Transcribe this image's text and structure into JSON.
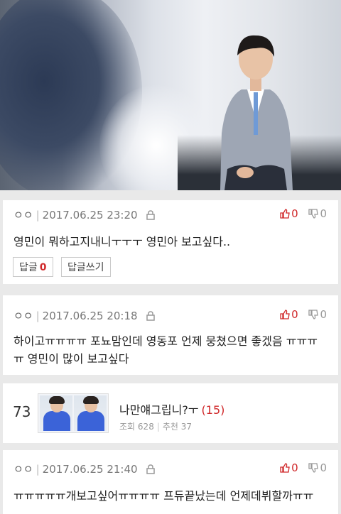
{
  "hero": {
    "alt": ""
  },
  "comments": [
    {
      "author": "ㅇㅇ",
      "date": "2017.06.25 23:20",
      "up": "0",
      "down": "0",
      "text": "영민이 뭐하고지내니ㅜㅜㅜ 영민아 보고싶다..",
      "reply_label": "답글",
      "reply_count": "0",
      "write_reply_label": "답글쓰기"
    },
    {
      "author": "ㅇㅇ",
      "date": "2017.06.25 20:18",
      "up": "0",
      "down": "0",
      "text": "하이고ㅠㅠㅠㅠ 포뇨맘인데 영동포 언제 뭉쳤으면 좋겠음 ㅠㅠㅠㅠ 영민이 많이 보고싶다"
    },
    {
      "author": "ㅇㅇ",
      "date": "2017.06.25 21:40",
      "up": "0",
      "down": "0",
      "text": "ㅠㅠㅠㅠㅠ개보고싶어ㅠㅠㅠㅠ 프듀끝났는데 언제데뷔할까ㅠㅠ"
    }
  ],
  "popular": {
    "rank": "73",
    "title": "나만얘그립니?ㅜ",
    "count": "(15)",
    "views_label": "조회",
    "views": "628",
    "rec_label": "추천",
    "rec": "37"
  }
}
